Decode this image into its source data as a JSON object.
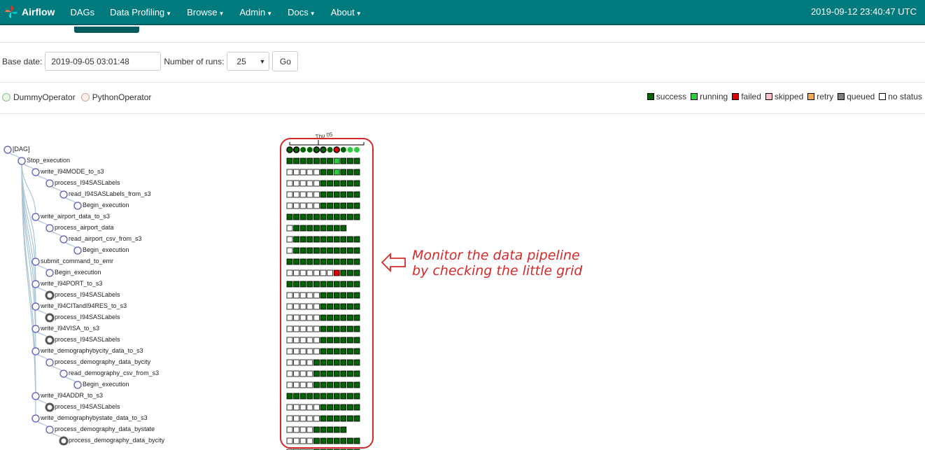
{
  "navbar": {
    "brand": "Airflow",
    "items": [
      {
        "label": "DAGs",
        "dropdown": false
      },
      {
        "label": "Data Profiling",
        "dropdown": true
      },
      {
        "label": "Browse",
        "dropdown": true
      },
      {
        "label": "Admin",
        "dropdown": true
      },
      {
        "label": "Docs",
        "dropdown": true
      },
      {
        "label": "About",
        "dropdown": true
      }
    ],
    "clock": "2019-09-12 23:40:47 UTC",
    "bg_color": "#017a7d"
  },
  "form": {
    "base_date_label": "Base date:",
    "base_date_value": "2019-09-05 03:01:48",
    "runs_label": "Number of runs:",
    "runs_value": "25",
    "go_label": "Go"
  },
  "operators": [
    {
      "label": "DummyOperator",
      "color": "#e8f7e4",
      "border": "#8fbc8f"
    },
    {
      "label": "PythonOperator",
      "color": "#ffefeb",
      "border": "#c7a89f"
    }
  ],
  "states": [
    {
      "label": "success",
      "color": "#006400"
    },
    {
      "label": "running",
      "color": "#2ecc40"
    },
    {
      "label": "failed",
      "color": "#dd0000"
    },
    {
      "label": "skipped",
      "color": "#ffc0cb"
    },
    {
      "label": "retry",
      "color": "#f0ad4e"
    },
    {
      "label": "queued",
      "color": "#808080"
    },
    {
      "label": "no status",
      "color": "#ffffff"
    }
  ],
  "tree": {
    "date_label": "Thu 05",
    "nodes": [
      {
        "label": "[DAG]",
        "depth": 0,
        "bold": false
      },
      {
        "label": "Stop_execution",
        "depth": 1,
        "bold": false
      },
      {
        "label": "write_I94MODE_to_s3",
        "depth": 2,
        "bold": false
      },
      {
        "label": "process_I94SASLabels",
        "depth": 3,
        "bold": false
      },
      {
        "label": "read_I94SASLabels_from_s3",
        "depth": 4,
        "bold": false
      },
      {
        "label": "Begin_execution",
        "depth": 5,
        "bold": false
      },
      {
        "label": "write_airport_data_to_s3",
        "depth": 2,
        "bold": false
      },
      {
        "label": "process_airport_data",
        "depth": 3,
        "bold": false
      },
      {
        "label": "read_airport_csv_from_s3",
        "depth": 4,
        "bold": false
      },
      {
        "label": "Begin_execution",
        "depth": 5,
        "bold": false
      },
      {
        "label": "submit_command_to_emr",
        "depth": 2,
        "bold": false
      },
      {
        "label": "Begin_execution",
        "depth": 3,
        "bold": false
      },
      {
        "label": "write_I94PORT_to_s3",
        "depth": 2,
        "bold": false
      },
      {
        "label": "process_I94SASLabels",
        "depth": 3,
        "bold": true
      },
      {
        "label": "write_I94CITandI94RES_to_s3",
        "depth": 2,
        "bold": false
      },
      {
        "label": "process_I94SASLabels",
        "depth": 3,
        "bold": true
      },
      {
        "label": "write_I94VISA_to_s3",
        "depth": 2,
        "bold": false
      },
      {
        "label": "process_I94SASLabels",
        "depth": 3,
        "bold": true
      },
      {
        "label": "write_demographybycity_data_to_s3",
        "depth": 2,
        "bold": false
      },
      {
        "label": "process_demography_data_bycity",
        "depth": 3,
        "bold": false
      },
      {
        "label": "read_demography_csv_from_s3",
        "depth": 4,
        "bold": false
      },
      {
        "label": "Begin_execution",
        "depth": 5,
        "bold": false
      },
      {
        "label": "write_I94ADDR_to_s3",
        "depth": 2,
        "bold": false
      },
      {
        "label": "process_I94SASLabels",
        "depth": 3,
        "bold": true
      },
      {
        "label": "write_demographybystate_data_to_s3",
        "depth": 2,
        "bold": false
      },
      {
        "label": "process_demography_data_bystate",
        "depth": 3,
        "bold": false
      },
      {
        "label": "process_demography_data_bycity",
        "depth": 4,
        "bold": true
      }
    ]
  },
  "grid": {
    "run_states": [
      "success",
      "success",
      "success",
      "success",
      "success",
      "success",
      "success",
      "failed",
      "success",
      "running",
      "running"
    ],
    "run_bold": [
      true,
      true,
      false,
      false,
      true,
      true,
      false,
      true,
      false,
      false,
      false
    ],
    "rows": [
      "sssssssrsss",
      "nnnnnssrsss",
      "nnnnnssssss",
      "nnnnnssssss",
      "nnnnnssssss",
      "sssssssssss",
      "nssssssss--",
      "nssssssssss",
      "nssssssssss",
      "sssssssssss",
      "nnnnnnnfsss",
      "sssssssssss",
      "nnnnnssssss",
      "nnnnnssssss",
      "nnnnnssssss",
      "nnnnnssssss",
      "nnnnnssssss",
      "nnnnnssssss",
      "nnnnsssssss",
      "nnnnsssssss",
      "nnnnsssssss",
      "sssssssssss",
      "nnnnnssssss",
      "nnnnnssssss",
      "nnnnsssss--",
      "nnnnsssssss",
      "nnnnsssssss"
    ]
  },
  "annotation": {
    "line1": "Monitor the data pipeline",
    "line2": "by checking the little grid",
    "color": "#d42a2a"
  }
}
